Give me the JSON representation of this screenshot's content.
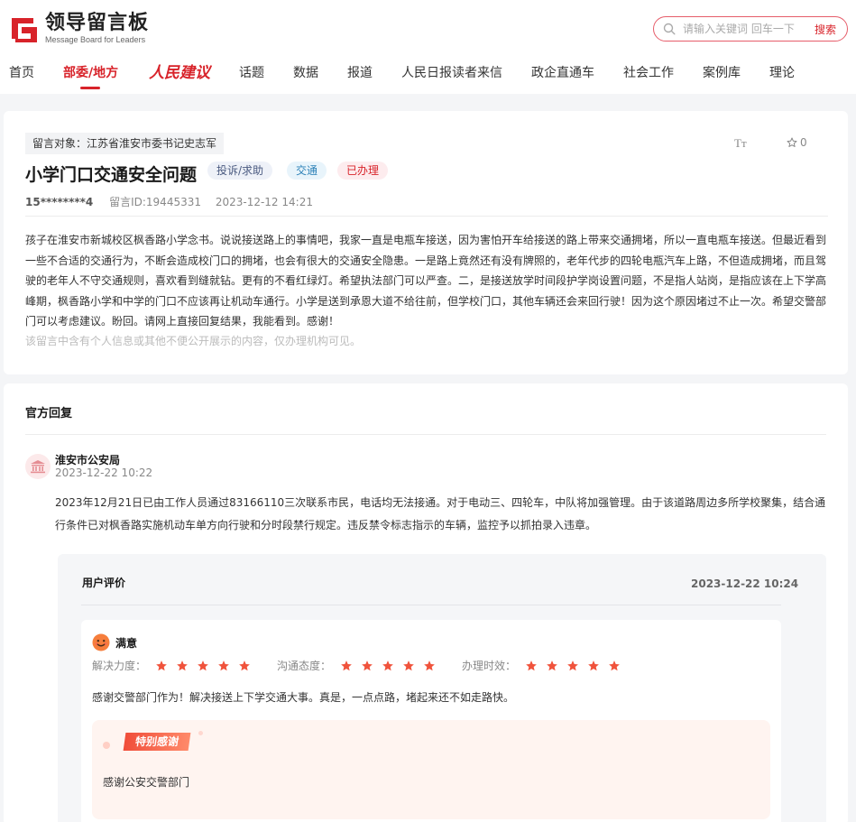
{
  "site": {
    "logo_title": "领导留言板",
    "logo_subtitle": "Message Board for Leaders",
    "brand_color": "#d8232a"
  },
  "search": {
    "placeholder": "请输入关键词 回车一下",
    "button_label": "搜索"
  },
  "nav": {
    "items": [
      {
        "label": "首页"
      },
      {
        "label": "部委/地方",
        "active": true
      },
      {
        "label": "人民建议"
      },
      {
        "label": "话题"
      },
      {
        "label": "数据"
      },
      {
        "label": "报道"
      },
      {
        "label": "人民日报读者来信"
      },
      {
        "label": "政企直通车"
      },
      {
        "label": "社会工作"
      },
      {
        "label": "案例库"
      },
      {
        "label": "理论"
      }
    ]
  },
  "message": {
    "target_label": "留言对象：江苏省淮安市委书记史志军",
    "font_toggle": "Tт",
    "favorite_count": "0",
    "title": "小学门口交通安全问题",
    "tags": {
      "type": "投诉/求助",
      "domain": "交通",
      "status": "已办理"
    },
    "user_id": "15********4",
    "message_id": "留言ID:19445331",
    "datetime": "2023-12-12 14:21",
    "body": "孩子在淮安市新城校区枫香路小学念书。说说接送路上的事情吧，我家一直是电瓶车接送，因为害怕开车给接送的路上带来交通拥堵，所以一直电瓶车接送。但最近看到一些不合适的交通行为，不断会造成校门口的拥堵，也会有很大的交通安全隐患。一是路上竟然还有没有牌照的，老年代步的四轮电瓶汽车上路，不但造成拥堵，而且驾驶的老年人不守交通规则，喜欢看到缝就钻。更有的不看红绿灯。希望执法部门可以严查。二，是接送放学时间段护学岗设置问题，不是指人站岗，是指应该在上下学高峰期，枫香路小学和中学的门口不应该再让机动车通行。小学是送到承恩大道不给往前，但学校门口，其他车辆还会来回行驶！因为这个原因堵过不止一次。希望交警部门可以考虑建议。盼回。请网上直接回复结果，我能看到。感谢！",
    "privacy_note": "该留言中含有个人信息或其他不便公开展示的内容，仅办理机构可见。"
  },
  "reply": {
    "heading": "官方回复",
    "org_name": "淮安市公安局",
    "org_time": "2023-12-22 10:22",
    "body": "2023年12月21日已由工作人员通过83166110三次联系市民，电话均无法接通。对于电动三、四轮车，中队将加强管理。由于该道路周边多所学校聚集，结合通行条件已对枫香路实施机动车单方向行驶和分时段禁行规定。违反禁令标志指示的车辆，监控予以抓拍录入违章。"
  },
  "evaluation": {
    "heading": "用户评价",
    "datetime": "2023-12-22 10:24",
    "mood": "满意",
    "ratings": [
      {
        "label": "解决力度：",
        "stars": 5
      },
      {
        "label": "沟通态度：",
        "stars": 5
      },
      {
        "label": "办理时效：",
        "stars": 5
      }
    ],
    "text": "感谢交警部门作为！解决接送上下学交通大事。真是，一点点路，堵起来还不如走路快。",
    "thanks_ribbon": "特别感谢",
    "thanks_text": "感谢公安交警部门"
  }
}
